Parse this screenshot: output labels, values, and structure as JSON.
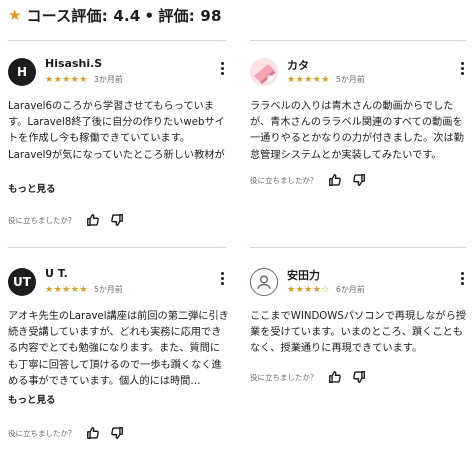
{
  "header": {
    "star_icon": "star-icon",
    "course_rating_label": "コース評価",
    "course_rating_value": "4.4",
    "separator": "•",
    "ratings_count_label": "評価",
    "ratings_count_value": "98"
  },
  "colors": {
    "star": "#e59819",
    "text": "#1c1d1f",
    "muted": "#6a6f73",
    "divider": "#d1d7dc"
  },
  "reviews": [
    {
      "avatar_text": "H",
      "name": "Hisashi.S",
      "stars": "★★★★★",
      "rating": 5,
      "time": "3か月前",
      "text": "Laravel6のころから学習させてもらっています。Laravel8終了後に自分の作りたいwebサイトを作成し今も稼働できていています。Laravel9が気になっていたところ新しい教材が発売されてやっと終えることができました。Carbo…",
      "read_more": "もっと見る",
      "helpful_question": "役に立ちましたか？"
    },
    {
      "avatar_text": "",
      "name": "カタ",
      "stars": "★★★★★",
      "rating": 5,
      "time": "5か月前",
      "text": "ララベルの入りは青木さんの動画からでしたが、青木さんのララベル関連のすべての動画を一通りやるとかなりの力が付きました。次は勤怠管理システムとか実装してみたいです。",
      "read_more": "",
      "helpful_question": "役に立ちましたか？"
    },
    {
      "avatar_text": "UT",
      "name": "U T.",
      "stars": "★★★★★",
      "rating": 5,
      "time": "5か月前",
      "text": "アオキ先生のLaravel講座は前回の第二弾に引き続き受講していますが、どれも実務に応用できる内容でとても勉強になります。また、質問にも丁寧に回答して頂けるので一歩も躓くなく進める事ができています。個人的には時間…",
      "read_more": "もっと見る",
      "helpful_question": "役に立ちましたか？"
    },
    {
      "avatar_text": "",
      "name": "安田力",
      "stars": "★★★★☆",
      "rating": 4,
      "time": "6か月前",
      "text": "ここまでWINDOWSパソコンで再現しながら授業を受けています。いまのところ、躓くこともなく、授業通りに再現できています。",
      "read_more": "",
      "helpful_question": "役に立ちましたか？"
    }
  ]
}
